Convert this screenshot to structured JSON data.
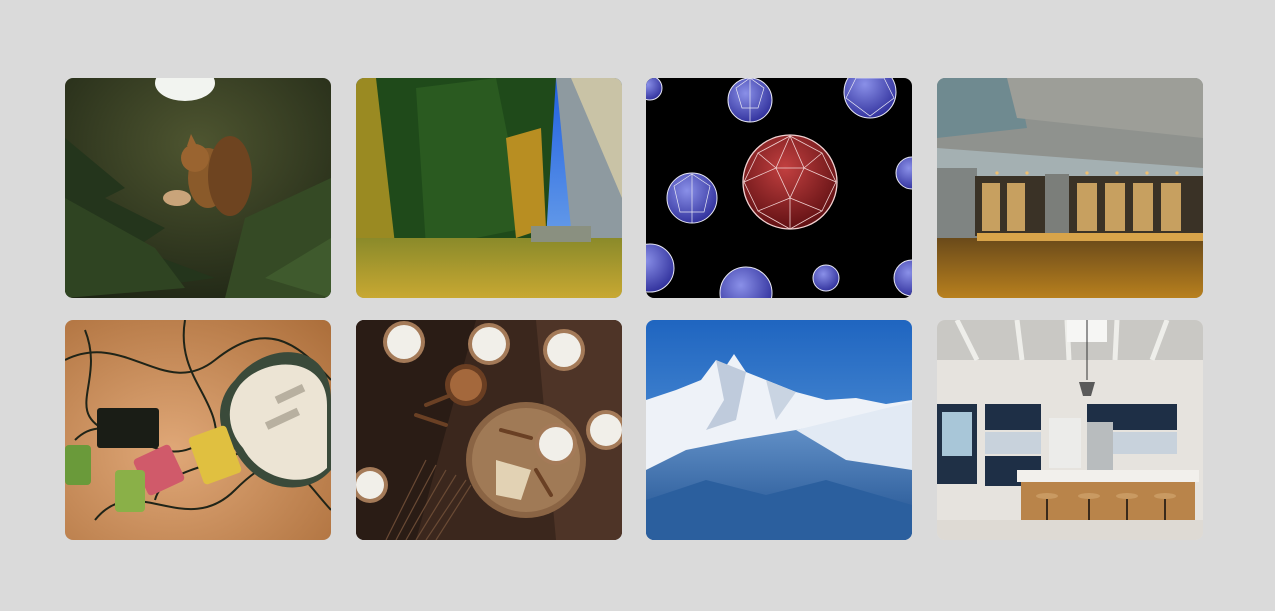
{
  "gallery": {
    "tiles": [
      {
        "subject": "squirrel-in-pine-tree",
        "dominant_color": "#3a3f22"
      },
      {
        "subject": "forest-meadow-blue-sky",
        "dominant_color": "#4f7a2a"
      },
      {
        "subject": "geodesic-spheres-on-black",
        "dominant_color": "#000000"
      },
      {
        "subject": "concrete-building-over-water",
        "dominant_color": "#8a8a86"
      },
      {
        "subject": "guitar-and-effect-pedals",
        "dominant_color": "#b07a4a"
      },
      {
        "subject": "milk-cups-and-cinnamon",
        "dominant_color": "#4a3226"
      },
      {
        "subject": "snowy-mountain-peaks",
        "dominant_color": "#2c6fb8"
      },
      {
        "subject": "modern-kitchen-interior",
        "dominant_color": "#e8e6e2"
      }
    ]
  },
  "colors": {
    "page_background": "#dadada"
  }
}
